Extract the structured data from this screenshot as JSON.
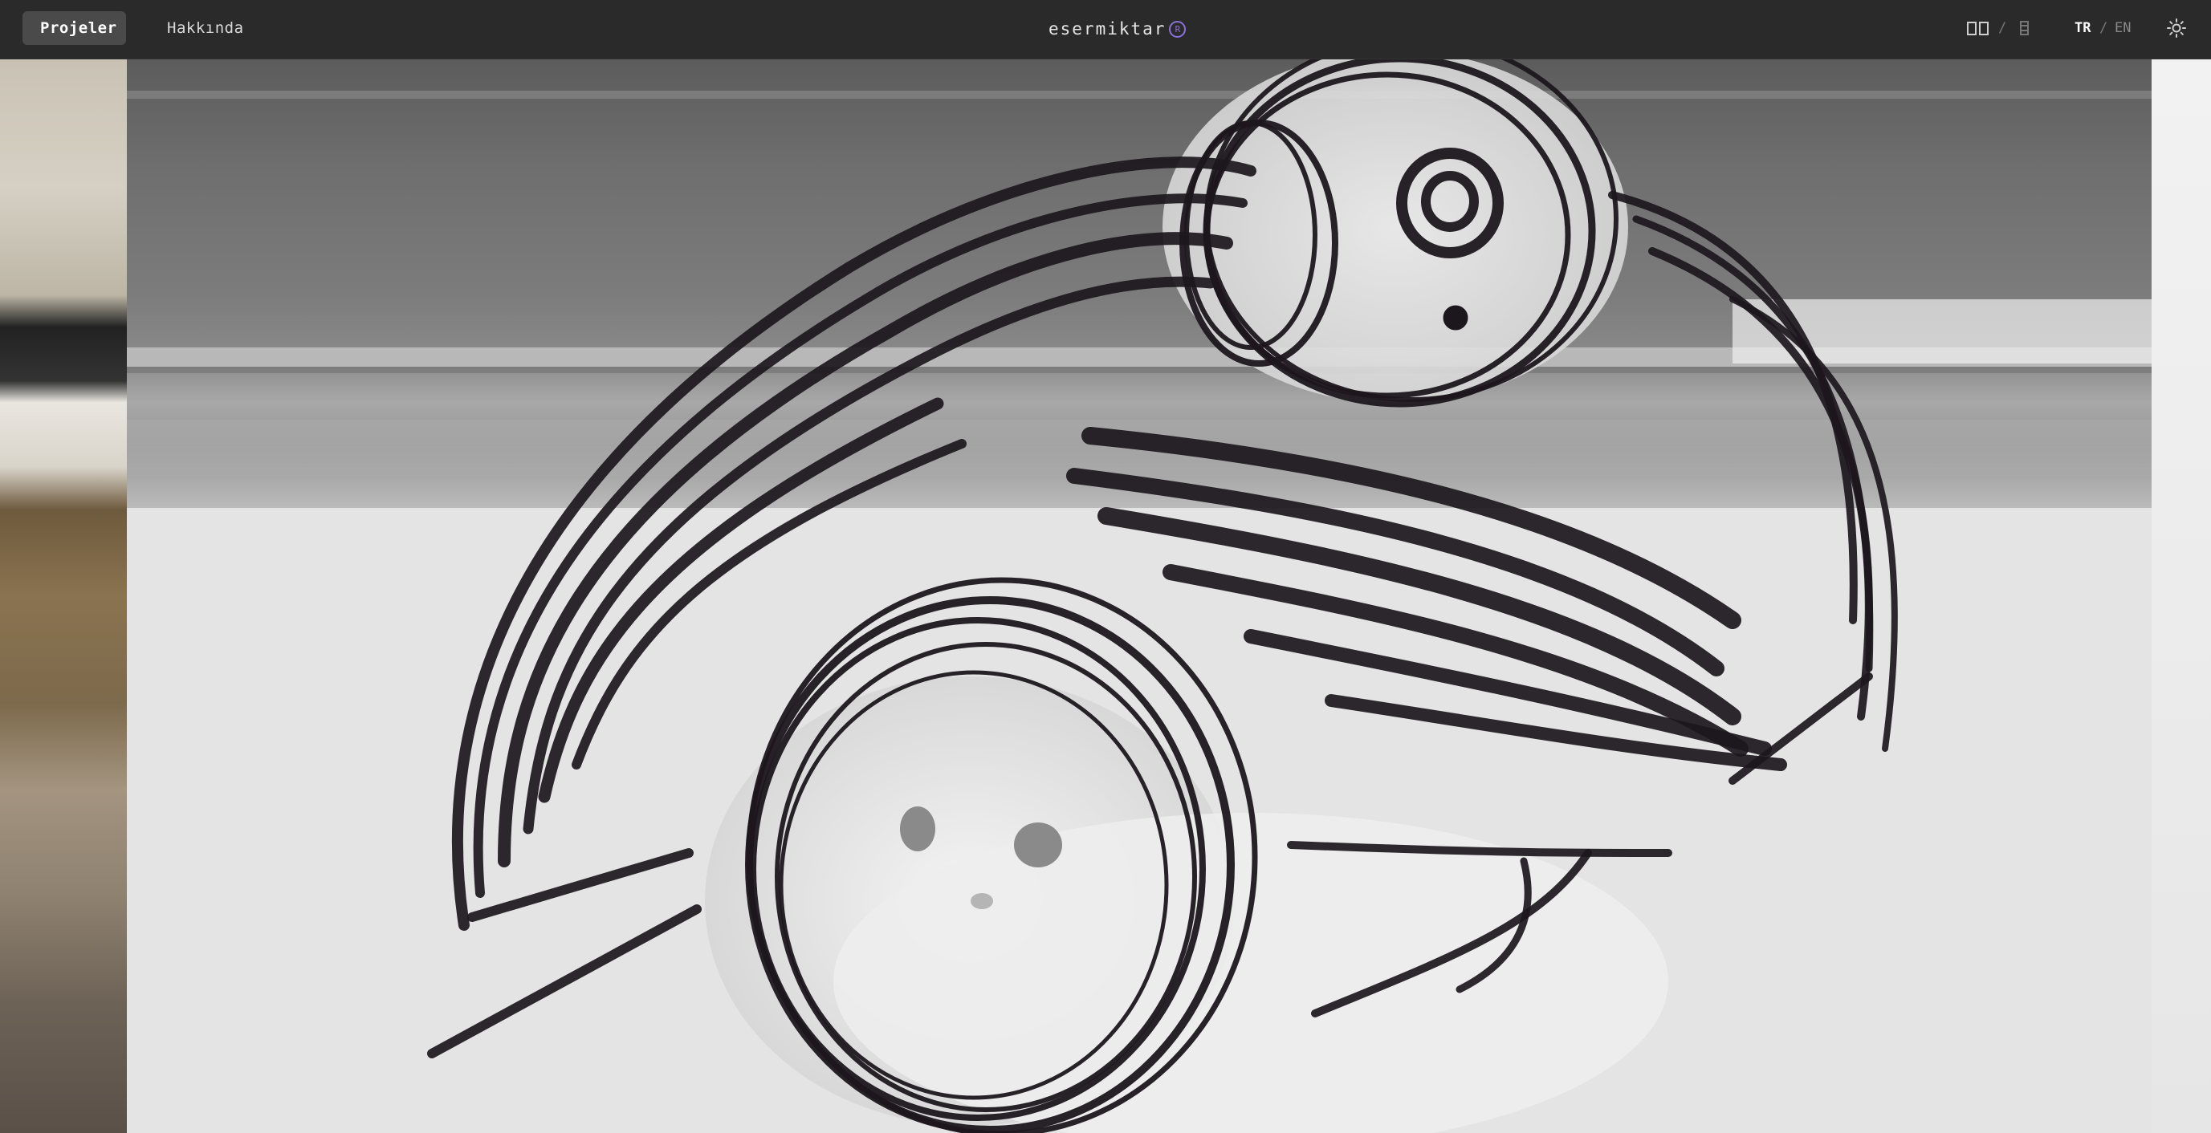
{
  "nav": {
    "projects_label": "Projeler",
    "about_label": "Hakkında"
  },
  "brand": {
    "name": "esermiktar",
    "reg_mark": "R"
  },
  "view_toggle": {
    "separator": "/",
    "active": "grid-view",
    "options": [
      "grid-view",
      "list-view"
    ]
  },
  "language": {
    "active": "TR",
    "tr_label": "TR",
    "separator": "/",
    "en_label": "EN"
  },
  "theme_toggle": {
    "icon": "sun-icon"
  },
  "gallery": {
    "images": [
      "left-neighbor-photo",
      "current-photo",
      "right-neighbor-photo"
    ]
  },
  "colors": {
    "topbar_bg": "#2a2a2a",
    "active_tab_bg": "#4a4a4a",
    "accent": "#8a72d6",
    "ink": "#1c171c"
  }
}
